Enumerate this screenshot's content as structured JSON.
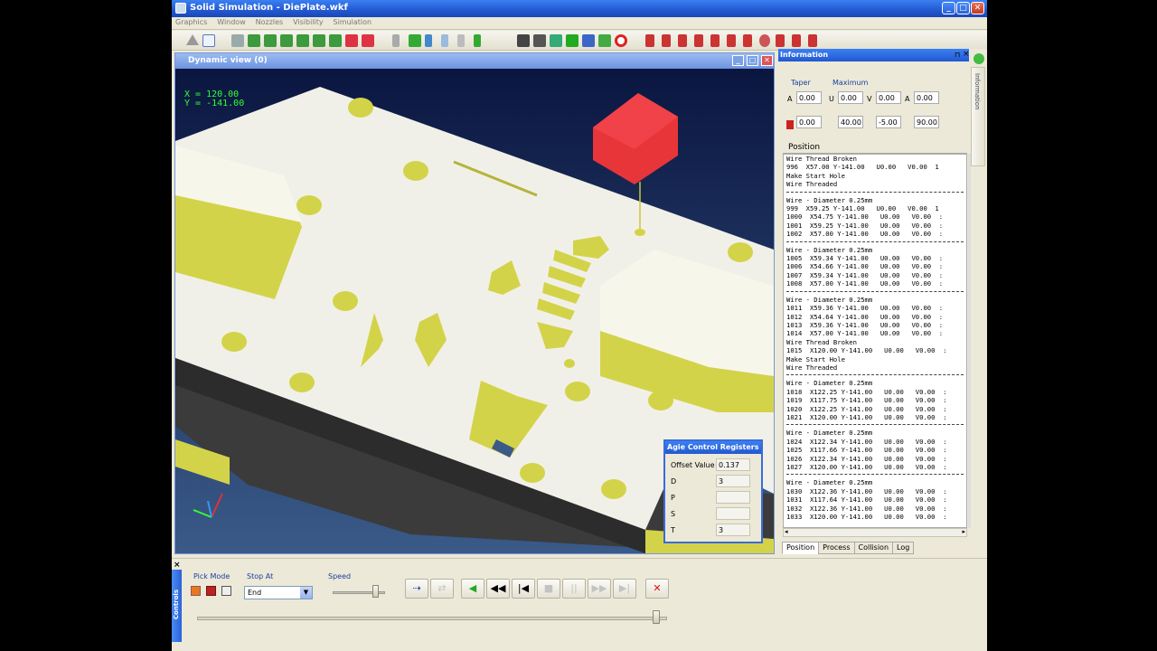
{
  "window": {
    "title": "Solid Simulation - DiePlate.wkf",
    "min": "_",
    "max": "□",
    "close": "✕"
  },
  "menu": [
    "Graphics",
    "Window",
    "Nozzles",
    "Visibility",
    "Simulation"
  ],
  "viewport": {
    "title": "Dynamic view (0)",
    "x_readout": "X = 120.00",
    "y_readout": "Y = -141.00"
  },
  "agie": {
    "title": "Agie Control Registers",
    "rows": [
      {
        "label": "Offset Value",
        "value": "0.137"
      },
      {
        "label": "D",
        "value": "3"
      },
      {
        "label": "P",
        "value": ""
      },
      {
        "label": "S",
        "value": ""
      },
      {
        "label": "T",
        "value": "3"
      }
    ]
  },
  "info": {
    "title": "Information",
    "side_tab": "Information",
    "taper_label": "Taper",
    "maximum_label": "Maximum",
    "row1_labels": [
      "A",
      "U",
      "V",
      "A"
    ],
    "row1_values": [
      "0.00",
      "0.00",
      "0.00",
      "0.00"
    ],
    "row2_values": [
      "0.00",
      "40.00",
      "-5.00",
      "90.00"
    ],
    "position_header": "Position",
    "position_lines": [
      "Wire Thread Broken",
      "996  X57.00 Y-141.00   U0.00   V0.00  1",
      "Make Start Hole",
      "Wire Threaded",
      "---",
      "Wire - Diameter 0.25mm",
      "999  X59.25 Y-141.00   U0.00   V0.00  1",
      "1000  X54.75 Y-141.00   U0.00   V0.00  :",
      "1001  X59.25 Y-141.00   U0.00   V0.00  :",
      "1002  X57.00 Y-141.00   U0.00   V0.00  :",
      "---",
      "Wire - Diameter 0.25mm",
      "1005  X59.34 Y-141.00   U0.00   V0.00  :",
      "1006  X54.66 Y-141.00   U0.00   V0.00  :",
      "1007  X59.34 Y-141.00   U0.00   V0.00  :",
      "1008  X57.00 Y-141.00   U0.00   V0.00  :",
      "---",
      "Wire - Diameter 0.25mm",
      "1011  X59.36 Y-141.00   U0.00   V0.00  :",
      "1012  X54.64 Y-141.00   U0.00   V0.00  :",
      "1013  X59.36 Y-141.00   U0.00   V0.00  :",
      "1014  X57.00 Y-141.00   U0.00   V0.00  :",
      "Wire Thread Broken",
      "1015  X120.00 Y-141.00   U0.00   V0.00  :",
      "Make Start Hole",
      "Wire Threaded",
      "---",
      "Wire - Diameter 0.25mm",
      "1018  X122.25 Y-141.00   U0.00   V0.00  :",
      "1019  X117.75 Y-141.00   U0.00   V0.00  :",
      "1020  X122.25 Y-141.00   U0.00   V0.00  :",
      "1021  X120.00 Y-141.00   U0.00   V0.00  :",
      "---",
      "Wire - Diameter 0.25mm",
      "1024  X122.34 Y-141.00   U0.00   V0.00  :",
      "1025  X117.66 Y-141.00   U0.00   V0.00  :",
      "1026  X122.34 Y-141.00   U0.00   V0.00  :",
      "1027  X120.00 Y-141.00   U0.00   V0.00  :",
      "---",
      "Wire - Diameter 0.25mm",
      "1030  X122.36 Y-141.00   U0.00   V0.00  :",
      "1031  X117.64 Y-141.00   U0.00   V0.00  :",
      "1032  X122.36 Y-141.00   U0.00   V0.00  :",
      "1033  X120.00 Y-141.00   U0.00   V0.00  :"
    ],
    "tabs": [
      "Position",
      "Process",
      "Collision",
      "Log"
    ]
  },
  "controls": {
    "side_label": "Controls",
    "close": "×",
    "pick_mode_label": "Pick Mode",
    "stop_at_label": "Stop At",
    "stop_at_value": "End",
    "speed_label": "Speed",
    "speed_level": 0.85,
    "progress_level": 0.98
  },
  "colors": {
    "part": "#f1f0e8",
    "holes": "#d3d34a",
    "cube": "#e8353a",
    "viewport_bg": "#0a1640",
    "titlebar": "#2358d0"
  }
}
